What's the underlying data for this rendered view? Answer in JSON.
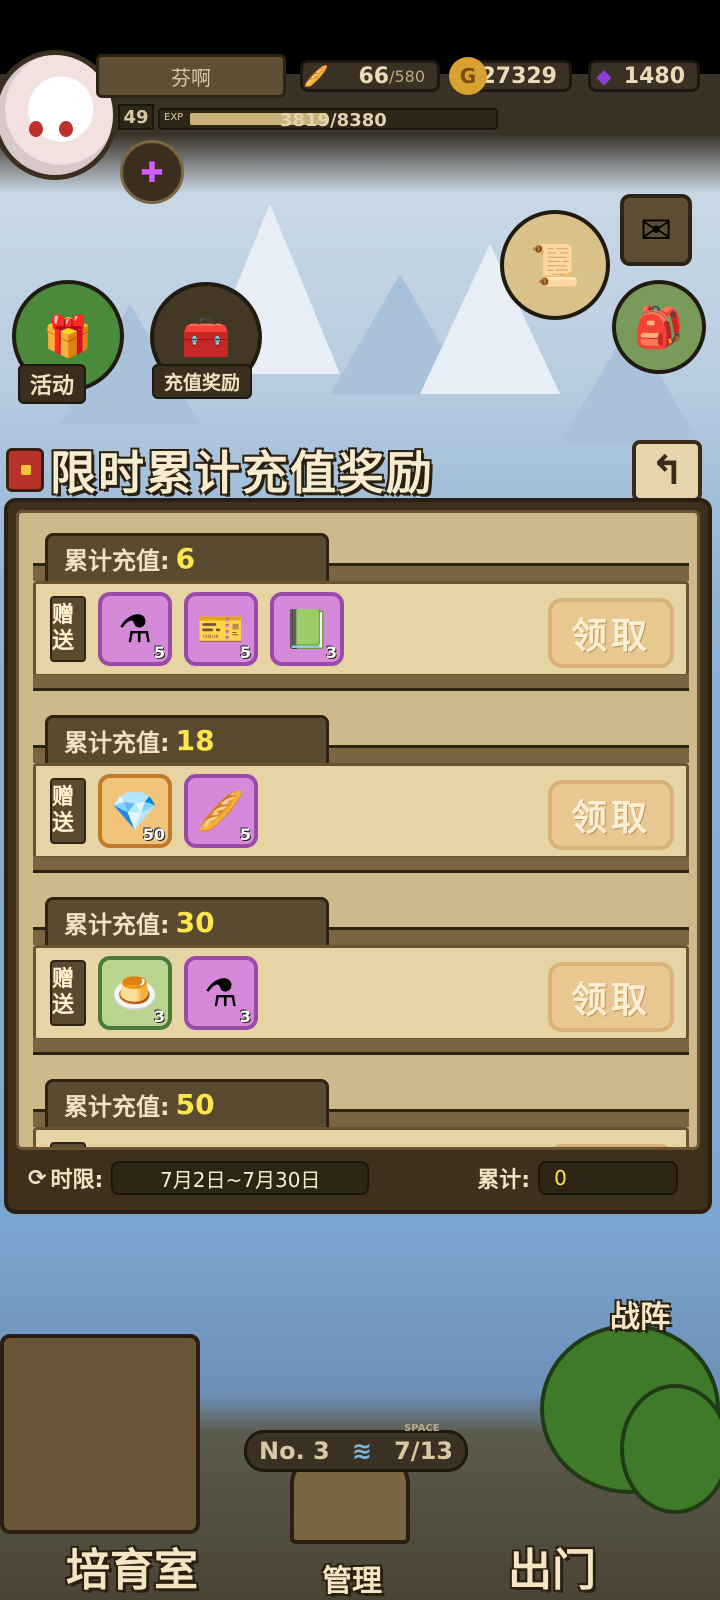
{
  "hud": {
    "player_name": "芬啊",
    "level": "49",
    "exp_tag": "EXP",
    "exp_text": "3819/8380",
    "exp_fraction": 0.456,
    "stamina_value": "66",
    "stamina_max": "/580",
    "gold": "27329",
    "gems": "1480"
  },
  "menu": {
    "activity_label": "活动",
    "recharge_reward_label": "充值奖励",
    "formation_label": "战阵"
  },
  "panel": {
    "title": "限时累计充值奖励",
    "gift_label": "赠送",
    "claim_label": "领取",
    "tier_prefix": "累计充值:",
    "tiers": [
      {
        "amount": "6",
        "items": [
          {
            "icon": "purple-potion-icon",
            "glyph": "⚗",
            "count": "5",
            "frame": "purple"
          },
          {
            "icon": "ticket-icon",
            "glyph": "🎫",
            "count": "5",
            "frame": "purple"
          },
          {
            "icon": "rainbow-book-icon",
            "glyph": "📗",
            "count": "3",
            "frame": "purple"
          }
        ]
      },
      {
        "amount": "18",
        "items": [
          {
            "icon": "purple-gem-icon",
            "glyph": "💎",
            "count": "50",
            "frame": "orange"
          },
          {
            "icon": "bread-basket-icon",
            "glyph": "🥖",
            "count": "5",
            "frame": "purple"
          }
        ]
      },
      {
        "amount": "30",
        "items": [
          {
            "icon": "pudding-icon",
            "glyph": "🍮",
            "count": "3",
            "frame": "green"
          },
          {
            "icon": "purple-potion-icon",
            "glyph": "⚗",
            "count": "3",
            "frame": "purple"
          }
        ]
      },
      {
        "amount": "50",
        "items": []
      }
    ],
    "footer": {
      "time_label": "时限:",
      "time_value": "7月2日~7月30日",
      "total_label": "累计:",
      "total_value": "0"
    }
  },
  "bottom": {
    "nursery_label": "培育室",
    "manage_label": "管理",
    "exit_label": "出门",
    "room_no": "No. 3",
    "space_tag": "SPACE",
    "space_value": "7/13"
  }
}
